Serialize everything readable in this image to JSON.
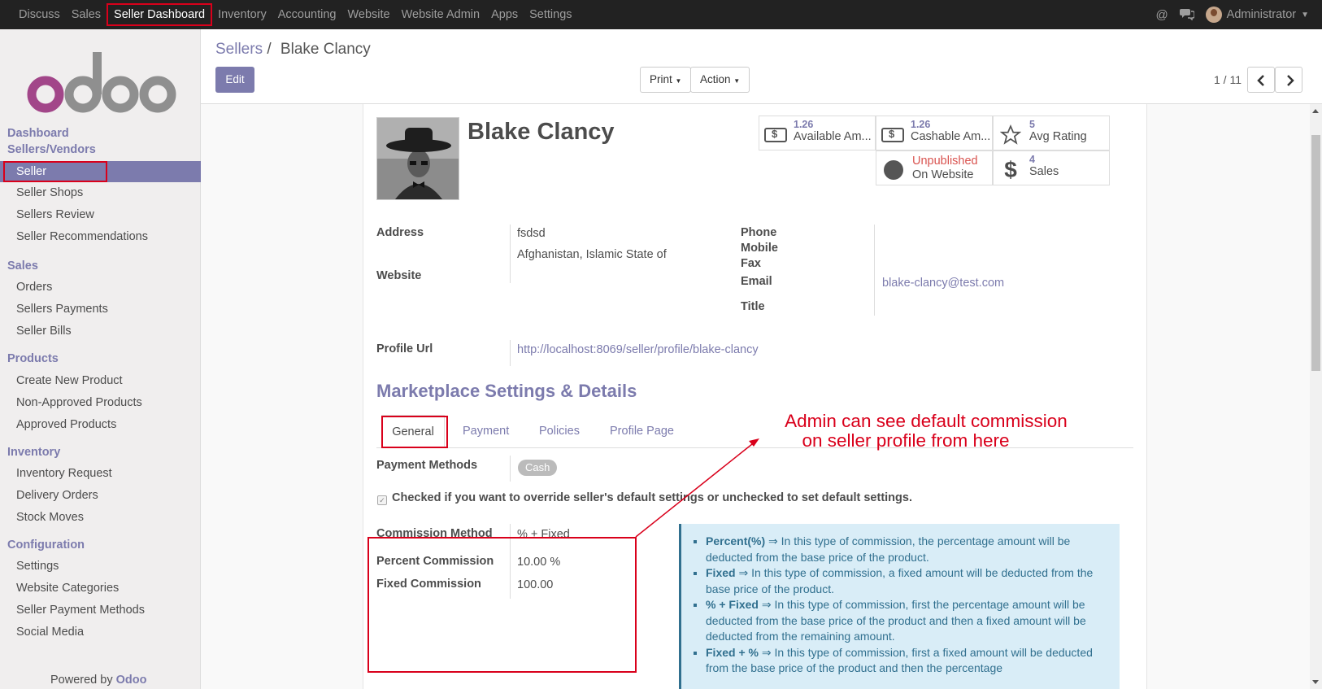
{
  "topbar": {
    "menu": [
      "Discuss",
      "Sales",
      "Seller Dashboard",
      "Inventory",
      "Accounting",
      "Website",
      "Website Admin",
      "Apps",
      "Settings"
    ],
    "user": "Administrator"
  },
  "sidebar": {
    "sections": {
      "dashboard": "Dashboard",
      "sellers_vendors": "Sellers/Vendors",
      "sales": "Sales",
      "products": "Products",
      "inventory": "Inventory",
      "configuration": "Configuration"
    },
    "items": {
      "seller": "Seller",
      "seller_shops": "Seller Shops",
      "sellers_review": "Sellers Review",
      "seller_recommendations": "Seller Recommendations",
      "orders": "Orders",
      "sellers_payments": "Sellers Payments",
      "seller_bills": "Seller Bills",
      "create_new_product": "Create New Product",
      "non_approved_products": "Non-Approved Products",
      "approved_products": "Approved Products",
      "inventory_request": "Inventory Request",
      "delivery_orders": "Delivery Orders",
      "stock_moves": "Stock Moves",
      "settings": "Settings",
      "website_categories": "Website Categories",
      "seller_payment_methods": "Seller Payment Methods",
      "social_media": "Social Media"
    },
    "powered_by": "Powered by",
    "brand": "Odoo"
  },
  "control_panel": {
    "breadcrumb_parent": "Sellers",
    "breadcrumb_sep": "/",
    "breadcrumb_current": "Blake Clancy",
    "edit": "Edit",
    "print": "Print",
    "action": "Action",
    "pager": "1 / 11"
  },
  "seller": {
    "name": "Blake Clancy",
    "stats": {
      "available_amount": "1.26",
      "available_label": "Available Am...",
      "cashable_amount": "1.26",
      "cashable_label": "Cashable Am...",
      "avg_rating": "5",
      "avg_rating_label": "Avg Rating",
      "website_state": "Unpublished",
      "website_label": "On Website",
      "sales": "4",
      "sales_label": "Sales"
    },
    "labels": {
      "address": "Address",
      "website": "Website",
      "phone": "Phone",
      "mobile": "Mobile",
      "fax": "Fax",
      "email": "Email",
      "title": "Title",
      "profile_url": "Profile Url"
    },
    "address_line1": "fsdsd",
    "address_line2": "Afghanistan, Islamic State of",
    "email": "blake-clancy@test.com",
    "profile_url": "http://localhost:8069/seller/profile/blake-clancy"
  },
  "marketplace": {
    "title": "Marketplace Settings & Details",
    "tabs": [
      "General",
      "Payment",
      "Policies",
      "Profile Page"
    ],
    "payment_methods_label": "Payment Methods",
    "payment_method_badge": "Cash",
    "override_text": "Checked if you want to override seller's default settings or unchecked to set default settings.",
    "commission_method_label": "Commission Method",
    "commission_method_value": "% + Fixed",
    "percent_commission_label": "Percent Commission",
    "percent_commission_value": "10.00 %",
    "fixed_commission_label": "Fixed Commission",
    "fixed_commission_value": "100.00",
    "help": [
      {
        "title": "Percent(%)",
        "text": "⇒ In this type of commission, the percentage amount will be deducted from the base price of the product."
      },
      {
        "title": "Fixed",
        "text": "⇒ In this type of commission, a fixed amount will be deducted from the base price of the product."
      },
      {
        "title": "% + Fixed",
        "text": "⇒ In this type of commission, first the percentage amount will be deducted from the base price of the product and then a fixed amount will be deducted from the remaining amount."
      },
      {
        "title": "Fixed + %",
        "text": "⇒ In this type of commission, first a fixed amount will be deducted from the base price of the product and then the percentage"
      }
    ]
  },
  "annotation": {
    "line1": "Admin can see default commission",
    "line2": "on seller profile from here",
    "color": "#d9001b"
  },
  "colors": {
    "brand": "#7c7bad",
    "topbar": "#222222",
    "highlight": "#d9001b"
  }
}
